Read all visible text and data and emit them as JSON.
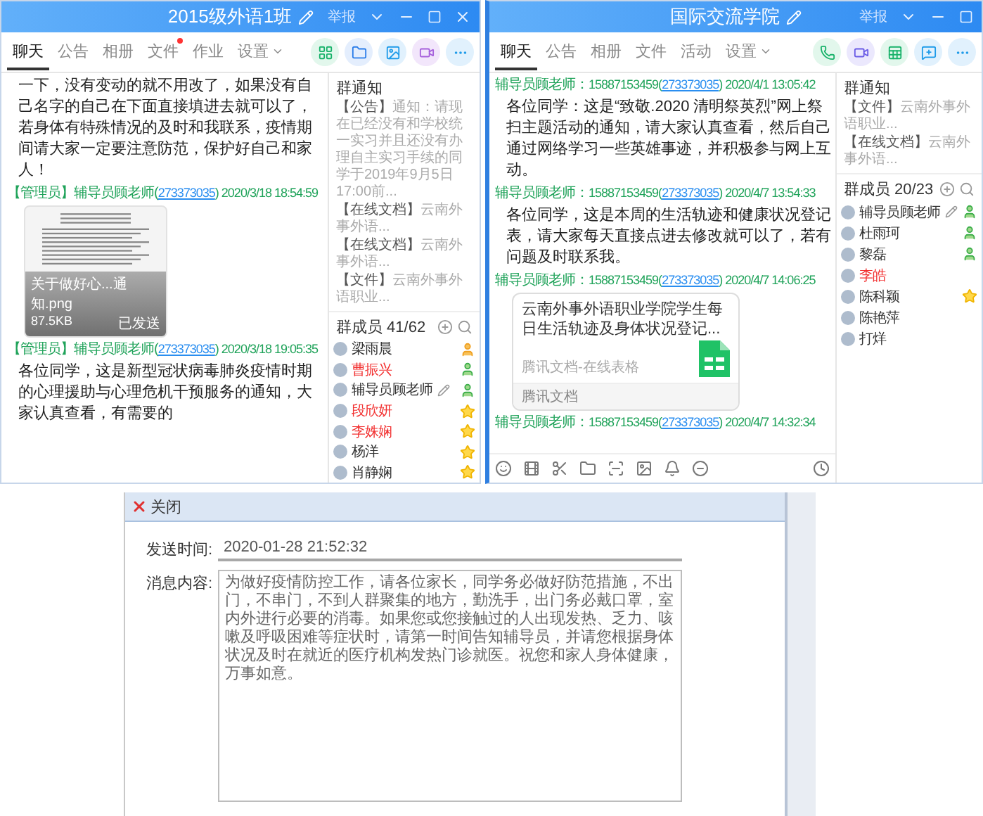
{
  "windows": [
    {
      "title": "2015级外语1班",
      "report": "举报",
      "closable": true,
      "tabs": [
        {
          "label": "聊天",
          "selected": true,
          "dot": false,
          "menu": false
        },
        {
          "label": "公告",
          "selected": false,
          "dot": false,
          "menu": false
        },
        {
          "label": "相册",
          "selected": false,
          "dot": false,
          "menu": false
        },
        {
          "label": "文件",
          "selected": false,
          "dot": true,
          "menu": false
        },
        {
          "label": "作业",
          "selected": false,
          "dot": false,
          "menu": false
        },
        {
          "label": "设置",
          "selected": false,
          "dot": false,
          "menu": true
        }
      ],
      "toolbar": [
        {
          "kind": "apps"
        },
        {
          "kind": "folder"
        },
        {
          "kind": "image"
        },
        {
          "kind": "video"
        },
        {
          "kind": "more"
        }
      ],
      "messages": [
        {
          "kind": "text",
          "text": "一下，没有变动的就不用改了，如果没有自己名字的自己在下面直接填进去就可以了，若身体有特殊情况的及时和我联系，疫情期间请大家一定要注意防范，保护好自己和家人！"
        },
        {
          "kind": "header",
          "role": "【管理员】",
          "name": "辅导员顾老师(",
          "qq": "273373035",
          "close": ")",
          "time": "2020/3/18 18:54:59"
        },
        {
          "kind": "image",
          "caption": "关于做好心...通知.png",
          "size": "87.5KB",
          "status": "已发送"
        },
        {
          "kind": "header",
          "role": "【管理员】",
          "name": "辅导员顾老师(",
          "qq": "273373035",
          "close": ")",
          "time": "2020/3/18 19:05:35"
        },
        {
          "kind": "text",
          "text": "各位同学，这是新型冠状病毒肺炎疫情时期的心理援助与心理危机干预服务的通知，大家认真查看，有需要的"
        }
      ],
      "notice": {
        "title": "群通知",
        "items": [
          {
            "tag": "【公告】",
            "text": "通知：请现在已经没有和学校统一实习并且还没有办理自主实习手续的同学于2019年9月5日17:00前..."
          },
          {
            "tag": "【在线文档】",
            "text": "云南外事外语..."
          },
          {
            "tag": "【在线文档】",
            "text": "云南外事外语..."
          },
          {
            "tag": "【文件】",
            "text": "云南外事外语职业..."
          }
        ]
      },
      "members": {
        "title": "群成员 41/62",
        "items": [
          {
            "name": "梁雨晨",
            "highlight": false,
            "editable": false,
            "kind": "owner"
          },
          {
            "name": "曹振兴",
            "highlight": true,
            "editable": false,
            "kind": "admin"
          },
          {
            "name": "辅导员顾老师",
            "highlight": false,
            "editable": true,
            "kind": "admin"
          },
          {
            "name": "段欣妍",
            "highlight": true,
            "editable": false,
            "kind": "star"
          },
          {
            "name": "李姝娴",
            "highlight": true,
            "editable": false,
            "kind": "star"
          },
          {
            "name": "杨洋",
            "highlight": false,
            "editable": false,
            "kind": "star"
          },
          {
            "name": "肖静娴",
            "highlight": false,
            "editable": false,
            "kind": "star"
          }
        ]
      }
    },
    {
      "title": "国际交流学院",
      "report": "举报",
      "closable": false,
      "tabs": [
        {
          "label": "聊天",
          "selected": true,
          "dot": false,
          "menu": false
        },
        {
          "label": "公告",
          "selected": false,
          "dot": false,
          "menu": false
        },
        {
          "label": "相册",
          "selected": false,
          "dot": false,
          "menu": false
        },
        {
          "label": "文件",
          "selected": false,
          "dot": false,
          "menu": false
        },
        {
          "label": "活动",
          "selected": false,
          "dot": false,
          "menu": false
        },
        {
          "label": "设置",
          "selected": false,
          "dot": false,
          "menu": true
        }
      ],
      "toolbar": [
        {
          "kind": "phone"
        },
        {
          "kind": "videocall"
        },
        {
          "kind": "doc"
        },
        {
          "kind": "chat"
        },
        {
          "kind": "more"
        }
      ],
      "messages": [
        {
          "kind": "header",
          "name": "辅导员顾老师：15887153459(",
          "qq": "273373035",
          "close": ")",
          "time": "2020/4/1 13:05:42"
        },
        {
          "kind": "text",
          "text": "各位同学：这是“致敬.2020 清明祭英烈”网上祭扫主题活动的通知，请大家认真查看，然后自己通过网络学习一些英雄事迹，并积极参与网上互动。"
        },
        {
          "kind": "header",
          "name": "辅导员顾老师：15887153459(",
          "qq": "273373035",
          "close": ")",
          "time": "2020/4/7 13:54:33"
        },
        {
          "kind": "text",
          "text": "各位同学，这是本周的生活轨迹和健康状况登记表，请大家每天直接点进去修改就可以了，若有问题及时联系我。"
        },
        {
          "kind": "header",
          "name": "辅导员顾老师：15887153459(",
          "qq": "273373035",
          "close": ")",
          "time": "2020/4/7 14:06:25"
        },
        {
          "kind": "doc",
          "title": "云南外事外语职业学院学生每日生活轨迹及身体状况登记...",
          "subtitle": "腾讯文档-在线表格",
          "source": "腾讯文档"
        },
        {
          "kind": "header",
          "name": "辅导员顾老师：15887153459(",
          "qq": "273373035",
          "close": ")",
          "time": "2020/4/7 14:32:34"
        }
      ],
      "composer": [
        {
          "kind": "emoji"
        },
        {
          "kind": "gif"
        },
        {
          "kind": "scissors"
        },
        {
          "kind": "folder"
        },
        {
          "kind": "screenshot"
        },
        {
          "kind": "image"
        },
        {
          "kind": "bell"
        },
        {
          "kind": "minus"
        },
        {
          "kind": "history"
        }
      ],
      "notice": {
        "title": "群通知",
        "items": [
          {
            "tag": "【文件】",
            "text": "云南外事外语职业..."
          },
          {
            "tag": "【在线文档】",
            "text": "云南外事外语..."
          }
        ]
      },
      "members": {
        "title": "群成员 20/23",
        "items": [
          {
            "name": "辅导员顾老师",
            "highlight": false,
            "editable": true,
            "kind": "admin"
          },
          {
            "name": "杜雨珂",
            "highlight": false,
            "editable": false,
            "kind": "admin"
          },
          {
            "name": "黎磊",
            "highlight": false,
            "editable": false,
            "kind": "admin"
          },
          {
            "name": "李皓",
            "highlight": true,
            "editable": false,
            "kind": "none"
          },
          {
            "name": "陈科颖",
            "highlight": false,
            "editable": false,
            "kind": "star"
          },
          {
            "name": "陈艳萍",
            "highlight": false,
            "editable": false,
            "kind": "none"
          },
          {
            "name": "打烊",
            "highlight": false,
            "editable": false,
            "kind": "none"
          }
        ]
      }
    }
  ],
  "dialog": {
    "close": "关闭",
    "time_label": "发送时间:",
    "time": "2020-01-28 21:52:32",
    "content_label": "消息内容:",
    "content": "为做好疫情防控工作，请各位家长，同学务必做好防范措施，不出门，不串门，不到人群聚集的地方，勤洗手，出门务必戴口罩，室内外进行必要的消毒。如果您或您接触过的人出现发热、乏力、咳嗽及呼吸困难等症状时，请第一时间告知辅导员，并请您根据身体状况及时在就近的医疗机构发热门诊就医。祝您和家人身体健康，万事如意。"
  }
}
